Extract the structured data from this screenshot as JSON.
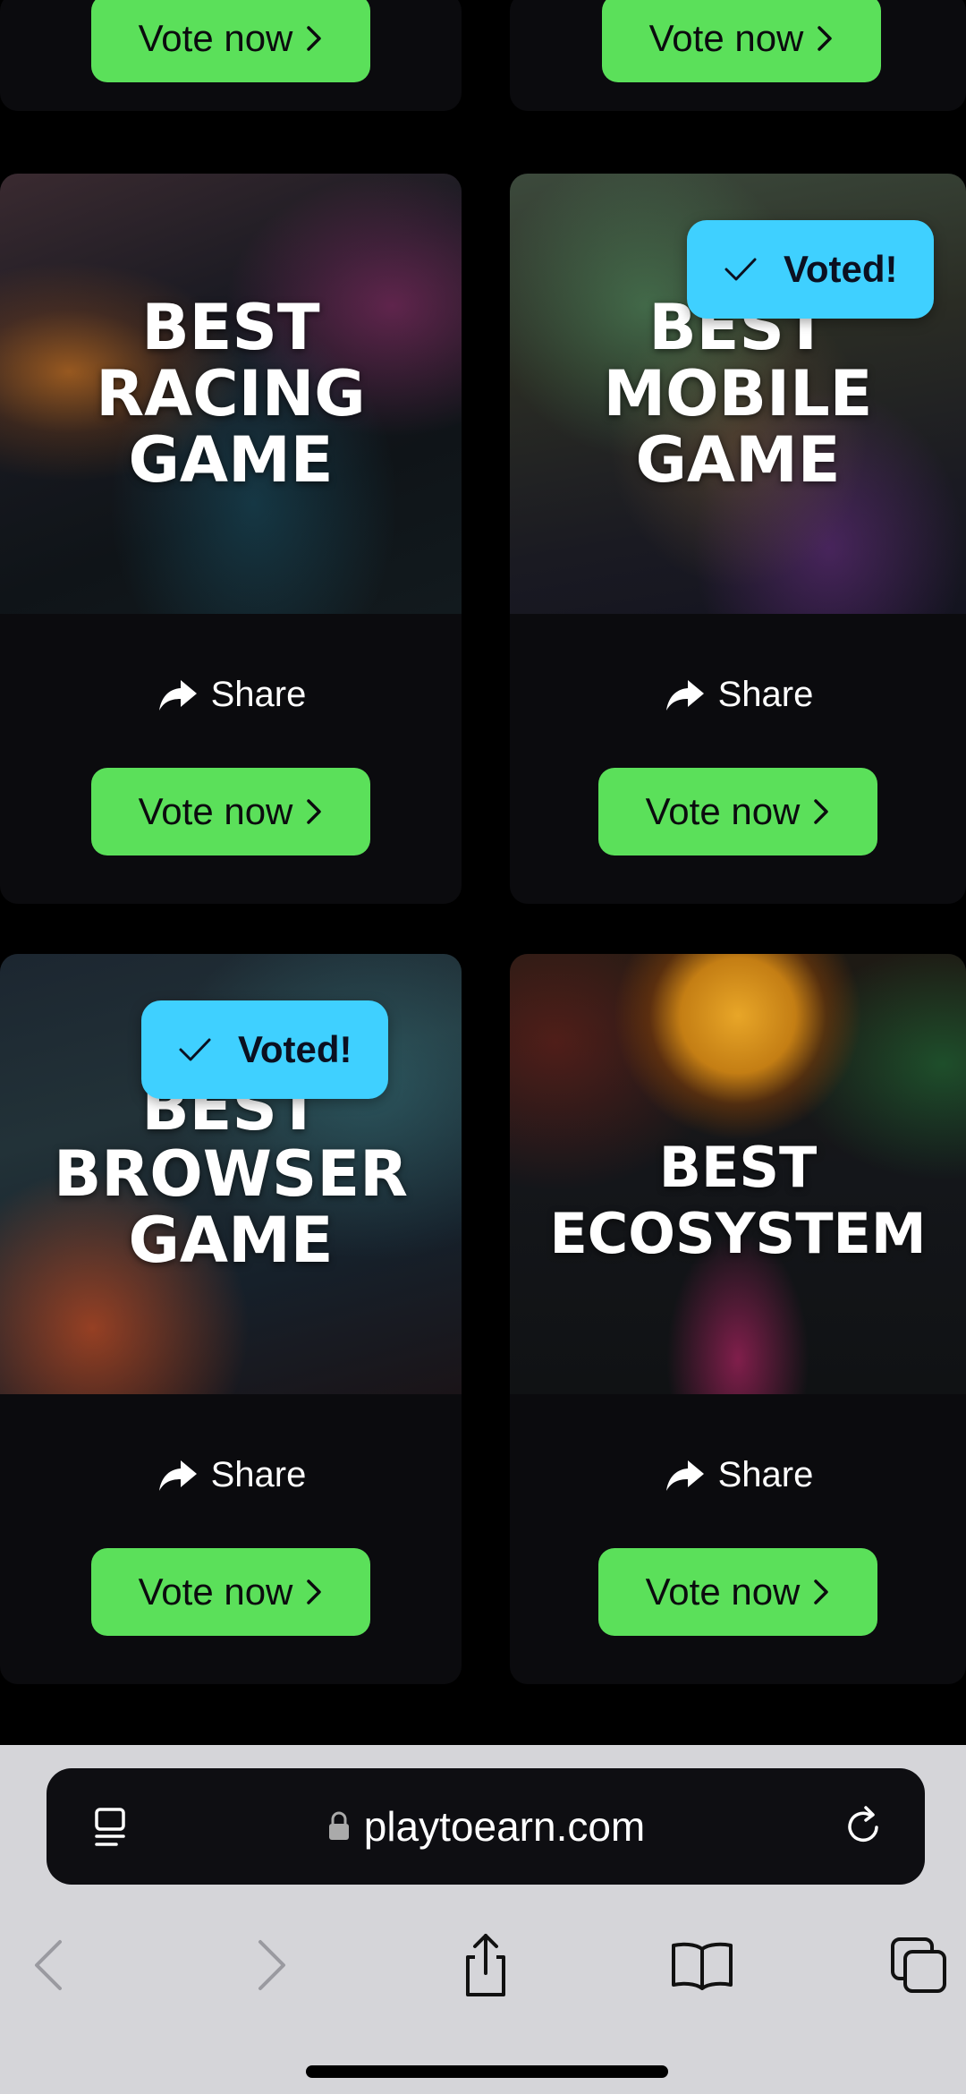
{
  "cards_top": [
    {
      "vote_label": "Vote now"
    },
    {
      "vote_label": "Vote now"
    }
  ],
  "cards": [
    {
      "title_lines": [
        "BEST",
        "RACING",
        "GAME"
      ],
      "share_label": "Share",
      "vote_label": "Vote now",
      "voted": false
    },
    {
      "title_lines": [
        "BEST",
        "MOBILE",
        "GAME"
      ],
      "share_label": "Share",
      "vote_label": "Vote now",
      "voted": true,
      "voted_label": "Voted!"
    },
    {
      "title_lines": [
        "BEST",
        "BROWSER",
        "GAME"
      ],
      "share_label": "Share",
      "vote_label": "Vote now",
      "voted": true,
      "voted_label": "Voted!"
    },
    {
      "title_lines": [
        "BEST",
        "ECOSYSTEM"
      ],
      "share_label": "Share",
      "vote_label": "Vote now",
      "voted": false
    }
  ],
  "browser": {
    "url": "playtoearn.com"
  },
  "colors": {
    "vote_button": "#5be05a",
    "voted_badge": "#3fd0ff",
    "card_bg": "#0b0b0e"
  },
  "icons": {
    "share": "share-arrow-icon",
    "chevron": "chevron-right-icon",
    "check": "check-icon",
    "reader": "reader-mode-icon",
    "lock": "lock-icon",
    "reload": "reload-icon",
    "back": "back-arrow-icon",
    "forward": "forward-arrow-icon",
    "share_sheet": "share-sheet-icon",
    "bookmarks": "bookmarks-icon",
    "tabs": "tabs-icon"
  }
}
